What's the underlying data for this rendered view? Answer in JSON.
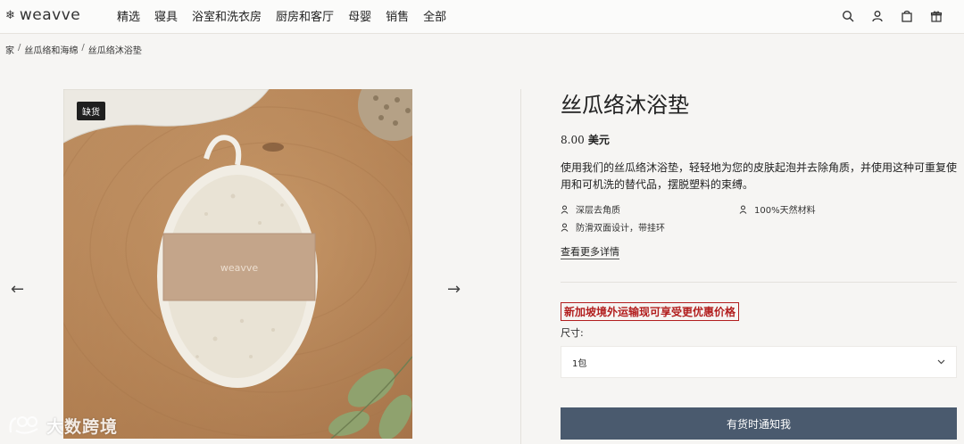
{
  "header": {
    "logo_text": "weavve",
    "nav": [
      "精选",
      "寝具",
      "浴室和洗衣房",
      "厨房和客厅",
      "母婴",
      "销售",
      "全部"
    ]
  },
  "breadcrumb": [
    "家",
    "丝瓜络和海绵",
    "丝瓜络沐浴垫"
  ],
  "gallery": {
    "badge": "缺货",
    "product_label_text": "weavve"
  },
  "product": {
    "title": "丝瓜络沐浴垫",
    "price_amount": "8.00",
    "price_currency": "美元",
    "description": "使用我们的丝瓜络沐浴垫，轻轻地为您的皮肤起泡并去除角质，并使用这种可重复使用和可机洗的替代品，摆脱塑料的束缚。",
    "features": [
      "深层去角质",
      "100%天然材料",
      "防滑双面设计，带挂环"
    ],
    "more_link": "查看更多详情",
    "promo": "新加坡境外运输现可享受更优惠价格",
    "size_label": "尺寸:",
    "size_value": "1包",
    "notify_button": "有货时通知我"
  },
  "watermark": {
    "text": "大数跨境"
  },
  "colors": {
    "button": "#4a5a6e",
    "promo": "#b21e1e",
    "badge": "#1f1f1f"
  }
}
